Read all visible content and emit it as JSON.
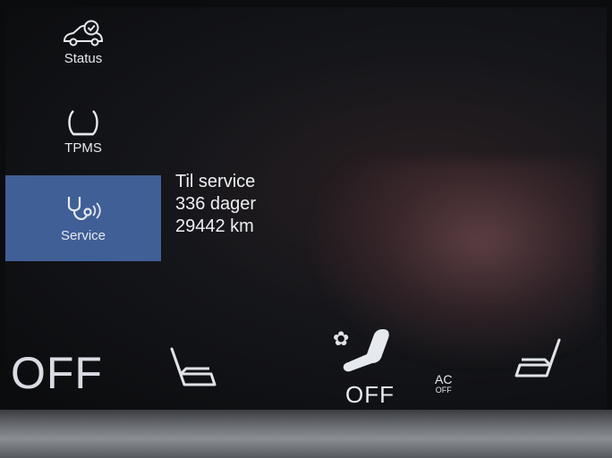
{
  "side_menu": {
    "items": [
      {
        "label": "Status",
        "icon": "car-check-icon",
        "active": false
      },
      {
        "label": "TPMS",
        "icon": "tire-pressure-icon",
        "active": false
      },
      {
        "label": "Service",
        "icon": "service-stethoscope-icon",
        "active": true
      }
    ]
  },
  "service_info": {
    "title": "Til service",
    "days": "336 dager",
    "distance": "29442 km"
  },
  "climate_bar": {
    "left_off": "OFF",
    "fan_icon": "fan-icon",
    "center_off": "OFF",
    "ac_label": "AC",
    "ac_sub": "OFF"
  },
  "colors": {
    "active_menu_bg": "#3f5f96",
    "text": "#e6e9ee",
    "accent_white": "#dfe3e8"
  }
}
